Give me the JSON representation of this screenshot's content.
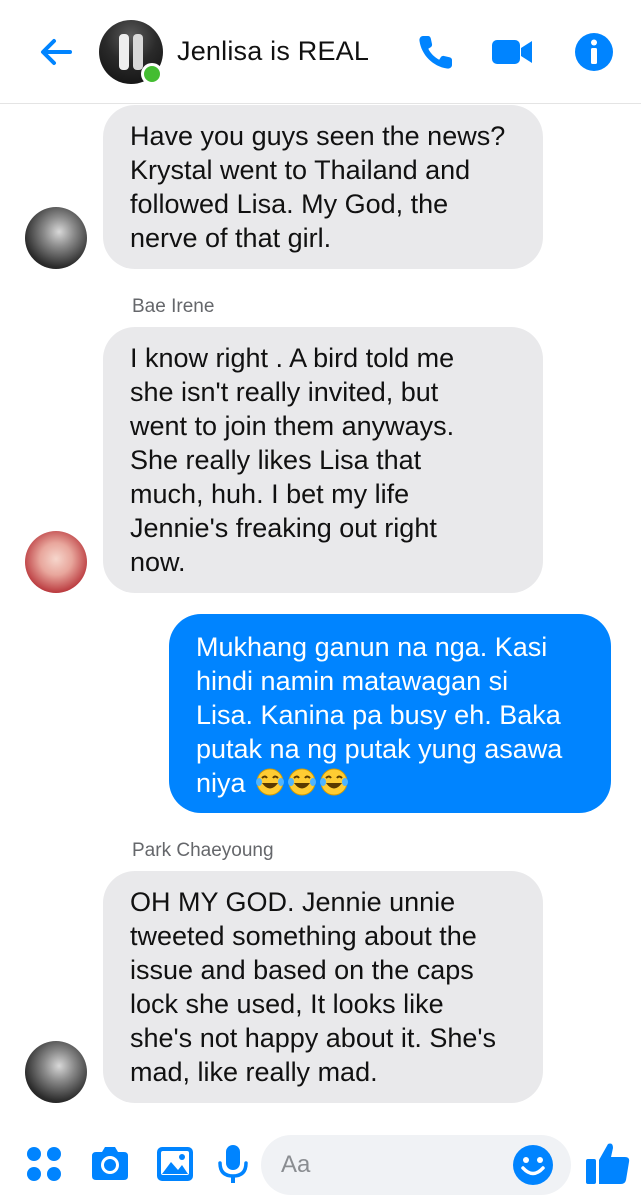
{
  "header": {
    "title": "Jenlisa is REAL",
    "back_icon": "back-arrow-icon",
    "call_icon": "phone-icon",
    "video_icon": "video-camera-icon",
    "info_icon": "info-icon",
    "online": true,
    "accent": "#0084ff",
    "online_color": "#44bd32"
  },
  "messages": [
    {
      "sender": "",
      "direction": "incoming",
      "lines": [
        "Have you guys seen the news?",
        "Krystal went to Thailand and",
        "followed Lisa. My God, the",
        "nerve of that girl."
      ]
    },
    {
      "sender": "Bae Irene",
      "direction": "incoming",
      "lines": [
        "I know right . A bird told me",
        "she isn't really invited, but",
        "went to join them anyways.",
        "She really likes Lisa that",
        "much, huh. I bet my life",
        "Jennie's freaking out right",
        "now."
      ]
    },
    {
      "sender": "",
      "direction": "outgoing",
      "lines": [
        "Mukhang ganun na nga. Kasi",
        "hindi namin matawagan si",
        "Lisa. Kanina pa busy eh. Baka",
        "putak na ng putak yung asawa",
        "niya"
      ],
      "emoji": "😂😂😂"
    },
    {
      "sender": "Park Chaeyoung",
      "direction": "incoming",
      "lines": [
        "OH MY GOD. Jennie unnie",
        "tweeted something about the",
        "issue and based on the caps",
        "lock she used, It looks like",
        "she's not happy about it. She's",
        "mad, like really mad."
      ]
    }
  ],
  "composer": {
    "placeholder": "Aa",
    "icons": [
      "apps-icon",
      "camera-icon",
      "image-icon",
      "microphone-icon",
      "emoji-icon",
      "thumbs-up-icon"
    ]
  },
  "colors": {
    "incoming_bubble": "#e9e9eb",
    "outgoing_bubble": "#0084ff"
  }
}
